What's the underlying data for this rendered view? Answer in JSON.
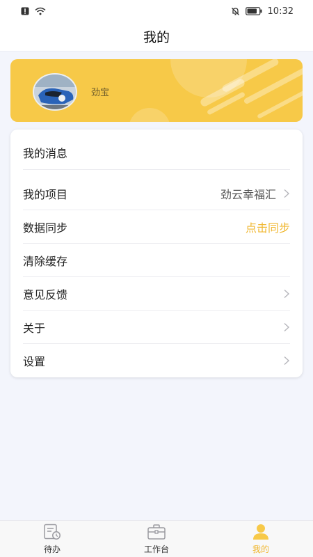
{
  "status_bar": {
    "time": "10:32"
  },
  "header": {
    "title": "我的"
  },
  "profile": {
    "name": "劲宝"
  },
  "menu": [
    {
      "label": "我的消息"
    },
    {
      "label": "我的项目",
      "value": "劲云幸福汇",
      "chevron": true
    },
    {
      "label": "数据同步",
      "action": "点击同步"
    },
    {
      "label": "清除缓存"
    },
    {
      "label": "意见反馈",
      "chevron": true
    },
    {
      "label": "关于",
      "chevron": true
    },
    {
      "label": "设置",
      "chevron": true
    }
  ],
  "tabs": [
    {
      "label": "待办",
      "icon": "todo-icon"
    },
    {
      "label": "工作台",
      "icon": "briefcase-icon"
    },
    {
      "label": "我的",
      "icon": "person-icon",
      "active": true
    }
  ],
  "colors": {
    "accent": "#f7c948",
    "accent_text": "#f0b72f",
    "background": "#f3f5fc"
  }
}
